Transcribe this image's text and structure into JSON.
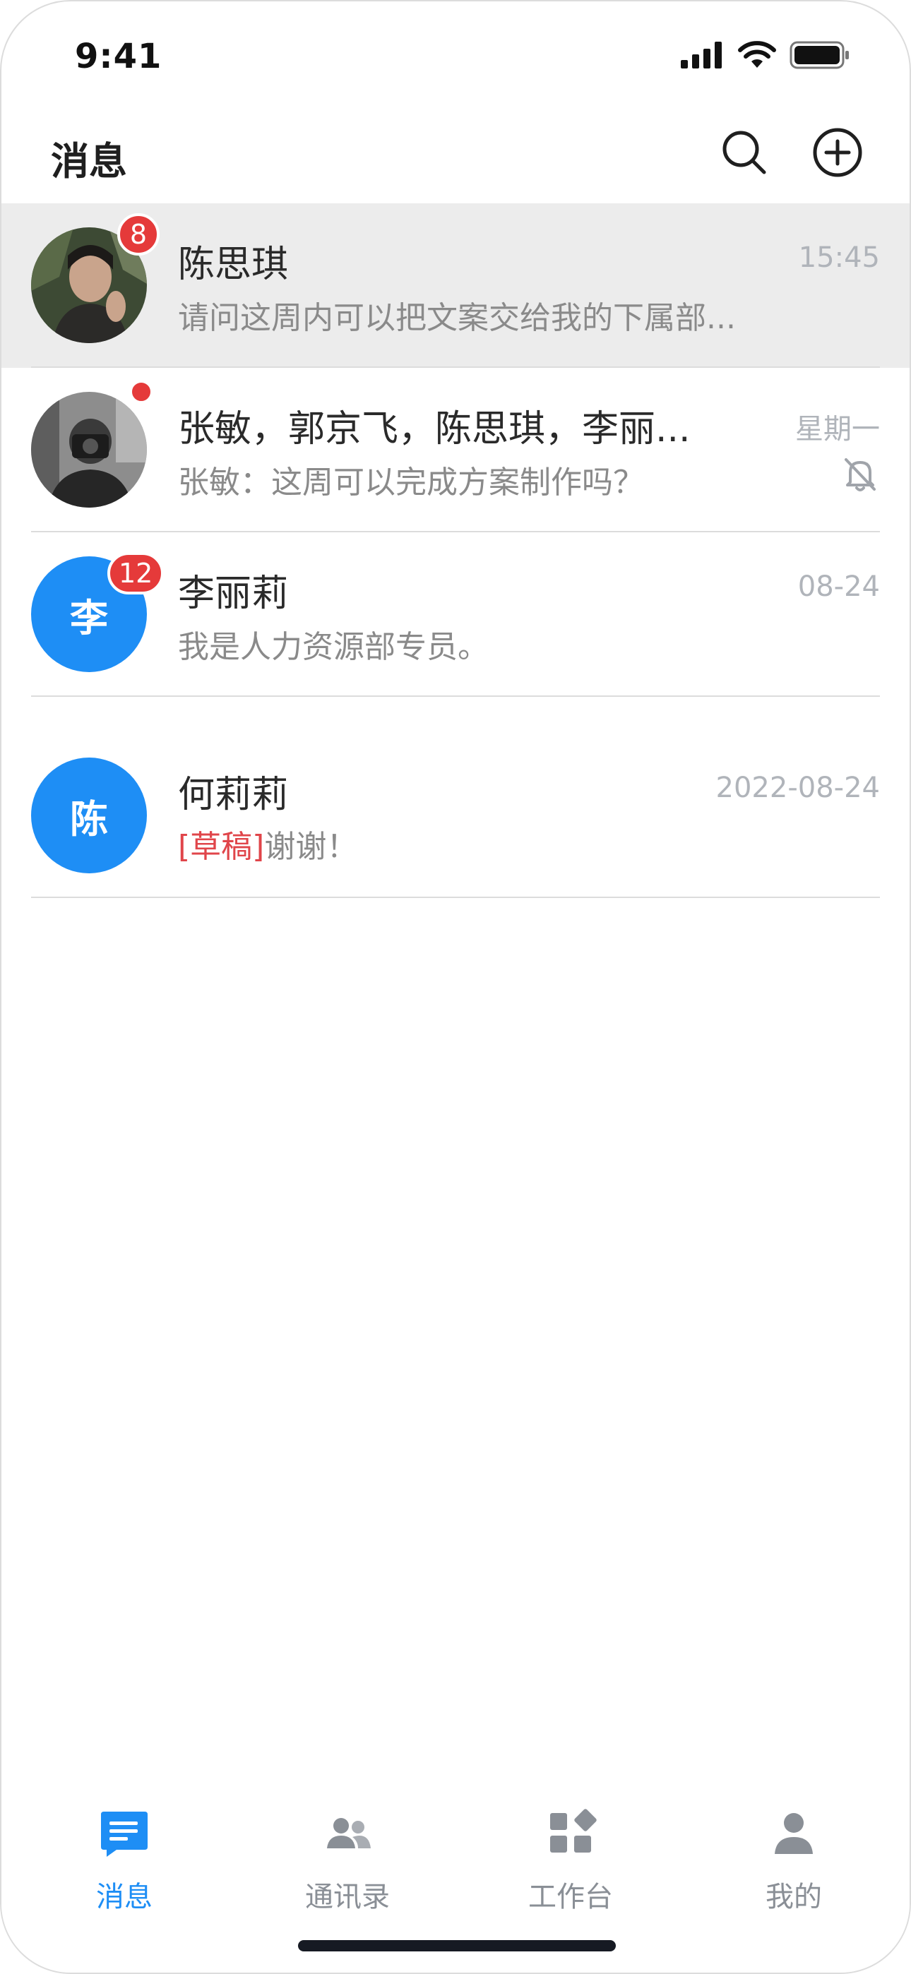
{
  "status_bar": {
    "time": "9:41"
  },
  "header": {
    "title": "消息"
  },
  "conversations": [
    {
      "name": "陈思琪",
      "preview": "请问这周内可以把文案交给我的下属部...",
      "time": "15:45",
      "badge": "8",
      "avatar_icon": "photo-avatar-woman"
    },
    {
      "name": "张敏，郭京飞，陈思琪，李丽...",
      "preview": "张敏：这周可以完成方案制作吗？",
      "time": "星期一",
      "avatar_icon": "photo-avatar-camera"
    },
    {
      "name": "李丽莉",
      "preview": "我是人力资源部专员。",
      "time": "08-24",
      "badge": "12",
      "avatar_text": "李"
    },
    {
      "name": "何莉莉",
      "draft_label": "[草稿]",
      "preview": "谢谢！",
      "time": "2022-08-24",
      "avatar_text": "陈"
    }
  ],
  "tabs": [
    {
      "label": "消息",
      "icon": "message-icon",
      "active": true
    },
    {
      "label": "通讯录",
      "icon": "contacts-icon"
    },
    {
      "label": "工作台",
      "icon": "workbench-icon"
    },
    {
      "label": "我的",
      "icon": "profile-icon"
    }
  ],
  "colors": {
    "accent": "#1e8ef5",
    "badge": "#e53a3a",
    "draft": "#e0454a",
    "highlight_row": "#ececec"
  }
}
